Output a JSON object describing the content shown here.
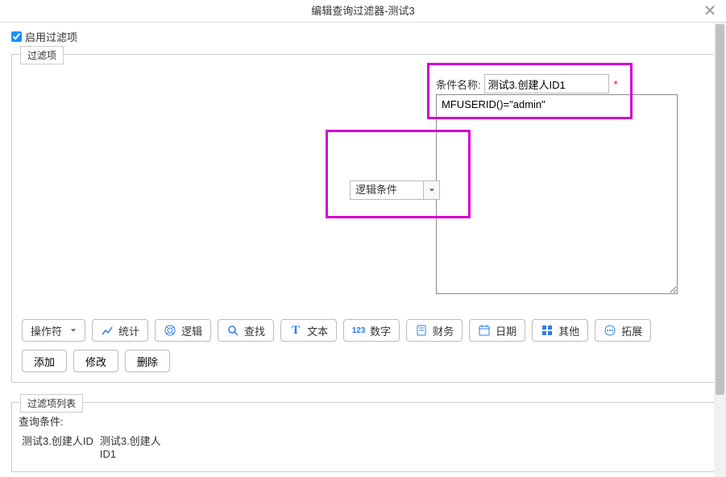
{
  "dialog": {
    "title": "编辑查询过滤器-测试3",
    "close_label": "✕"
  },
  "enable": {
    "checked": true,
    "label": "启用过滤项"
  },
  "filter_section": {
    "legend": "过滤项",
    "condition_name_label": "条件名称:",
    "condition_name_value": "测试3.创建人ID1",
    "expression_value": "MFUSERID()=\"admin\"",
    "logic_dropdown": "逻辑条件"
  },
  "toolbar": {
    "operator": "操作符",
    "stats": "统计",
    "logic": "逻辑",
    "find": "查找",
    "text": "文本",
    "number": "数字",
    "finance": "财务",
    "date": "日期",
    "other": "其他",
    "extend": "拓展"
  },
  "actions": {
    "add": "添加",
    "modify": "修改",
    "delete": "删除"
  },
  "list_section": {
    "legend": "过滤项列表",
    "query_label": "查询条件:",
    "items": [
      {
        "col1": "测试3.创建人ID",
        "col2": "测试3.创建人ID1"
      }
    ]
  }
}
